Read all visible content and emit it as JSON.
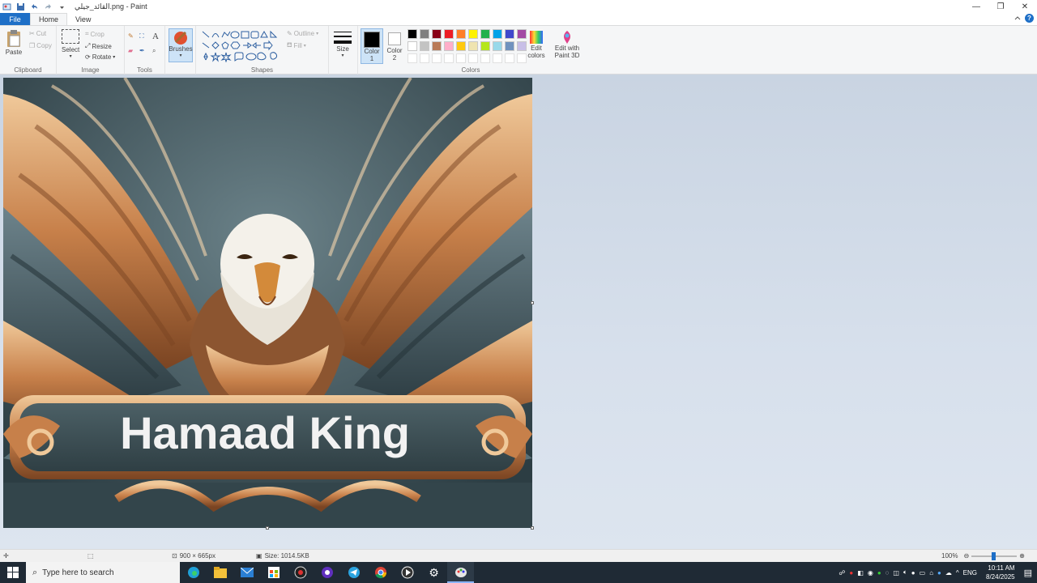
{
  "window": {
    "title": "القائد_جيلي.png - Paint",
    "controls": {
      "minimize": "—",
      "maximize": "❐",
      "close": "✕"
    }
  },
  "ribbon": {
    "tabs": {
      "file": "File",
      "home": "Home",
      "view": "View"
    },
    "clipboard": {
      "paste": "Paste",
      "cut": "Cut",
      "copy": "Copy",
      "label": "Clipboard"
    },
    "image": {
      "select": "Select",
      "crop": "Crop",
      "resize": "Resize",
      "rotate": "Rotate",
      "label": "Image"
    },
    "tools": {
      "label": "Tools"
    },
    "brushes": {
      "label": "Brushes"
    },
    "shapes": {
      "outline": "Outline",
      "fill": "Fill",
      "label": "Shapes"
    },
    "size": {
      "label": "Size"
    },
    "color1": {
      "label_line1": "Color",
      "label_line2": "1"
    },
    "color2": {
      "label_line1": "Color",
      "label_line2": "2"
    },
    "colors": {
      "label": "Colors",
      "edit_colors_line1": "Edit",
      "edit_colors_line2": "colors",
      "paint3d_line1": "Edit with",
      "paint3d_line2": "Paint 3D",
      "palette_row1": [
        "#000000",
        "#7f7f7f",
        "#880015",
        "#ed1c24",
        "#ff7f27",
        "#fff200",
        "#22b14c",
        "#00a2e8",
        "#3f48cc",
        "#a349a4"
      ],
      "palette_row2": [
        "#ffffff",
        "#c3c3c3",
        "#b97a57",
        "#ffaec9",
        "#ffc90e",
        "#efe4b0",
        "#b5e61d",
        "#99d9ea",
        "#7092be",
        "#c8bfe7"
      ],
      "palette_row3": [
        "#ffffff",
        "#ffffff",
        "#ffffff",
        "#ffffff",
        "#ffffff",
        "#ffffff",
        "#ffffff",
        "#ffffff",
        "#ffffff",
        "#ffffff"
      ]
    }
  },
  "canvas": {
    "banner_text": "Hamaad King"
  },
  "statusbar": {
    "dimensions": "900 × 665px",
    "size": "Size: 1014.5KB",
    "zoom": "100%"
  },
  "taskbar": {
    "search_placeholder": "Type here to search",
    "language": "ENG",
    "time": "10:11 AM",
    "date": "8/24/2025"
  }
}
